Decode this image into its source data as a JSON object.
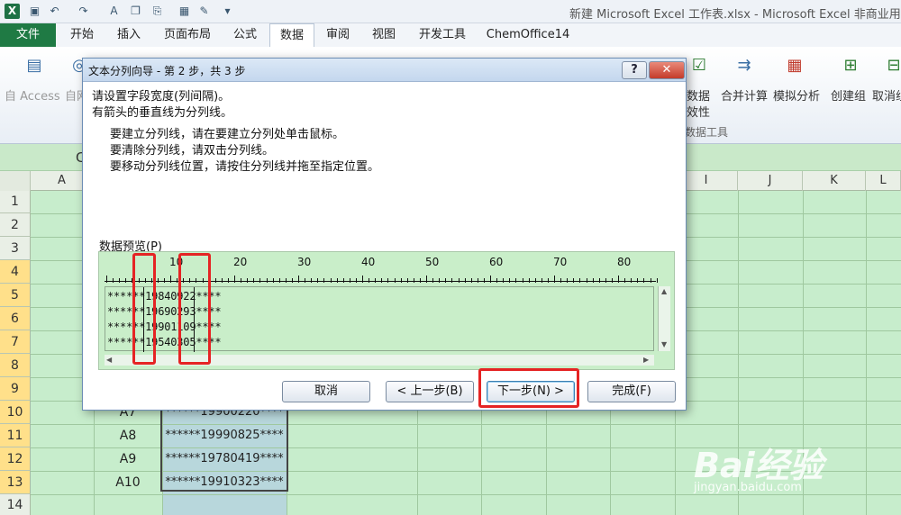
{
  "window": {
    "title": "新建 Microsoft Excel 工作表.xlsx - Microsoft Excel 非商业用"
  },
  "quick_access": [
    "excel-logo",
    "save-icon",
    "undo-icon",
    "redo-icon",
    "font-size-icon",
    "copy-icon",
    "paste-icon",
    "table-icon",
    "format-icon",
    "customize-icon"
  ],
  "tabs": [
    {
      "label": "文件"
    },
    {
      "label": "开始"
    },
    {
      "label": "插入"
    },
    {
      "label": "页面布局"
    },
    {
      "label": "公式"
    },
    {
      "label": "数据"
    },
    {
      "label": "审阅"
    },
    {
      "label": "视图"
    },
    {
      "label": "开发工具"
    },
    {
      "label": "ChemOffice14"
    }
  ],
  "ribbon": {
    "from_access": "自 Access",
    "from_web": "自网",
    "data_validity_1": "数据",
    "data_validity_2": "效性",
    "consolidate": "合并计算",
    "what_if": "模拟分析",
    "group": "创建组",
    "ungroup": "取消组",
    "data_tools_group": "数据工具"
  },
  "namebox_fragment": "C",
  "columns": [
    "A",
    "I",
    "J",
    "K",
    "L"
  ],
  "rows": [
    "1",
    "2",
    "3",
    "4",
    "5",
    "6",
    "7",
    "8",
    "9",
    "10",
    "11",
    "12",
    "13",
    "14"
  ],
  "visible_cells": [
    {
      "row": "10",
      "a": "A7",
      "b": "******19900220****"
    },
    {
      "row": "11",
      "a": "A8",
      "b": "******19990825****"
    },
    {
      "row": "12",
      "a": "A9",
      "b": "******19780419****"
    },
    {
      "row": "13",
      "a": "A10",
      "b": "******19910323****"
    }
  ],
  "dialog": {
    "title": "文本分列向导 - 第 2 步，共 3 步",
    "help_label": "?",
    "close_label": "✕",
    "instruction_1": "请设置字段宽度(列间隔)。",
    "instruction_2": "有箭头的垂直线为分列线。",
    "tip_1": "要建立分列线，请在要建立分列处单击鼠标。",
    "tip_2": "要清除分列线，请双击分列线。",
    "tip_3": "要移动分列线位置，请按住分列线并拖至指定位置。",
    "preview_label": "数据预览(P)",
    "ruler_numbers": [
      "10",
      "20",
      "30",
      "40",
      "50",
      "60",
      "70",
      "80"
    ],
    "preview_lines": [
      "******19840922****",
      "******19690293****",
      "******19901109****",
      "******19540305****"
    ],
    "buttons": {
      "cancel": "取消",
      "back": "< 上一步(B)",
      "next": "下一步(N) >",
      "finish": "完成(F)"
    }
  },
  "watermark": {
    "brand": "Bai经验",
    "url": "jingyan.baidu.com"
  },
  "colors": {
    "file_tab": "#1f7a44",
    "sheet_bg": "#c7edcc",
    "highlight_red": "#e52424"
  }
}
